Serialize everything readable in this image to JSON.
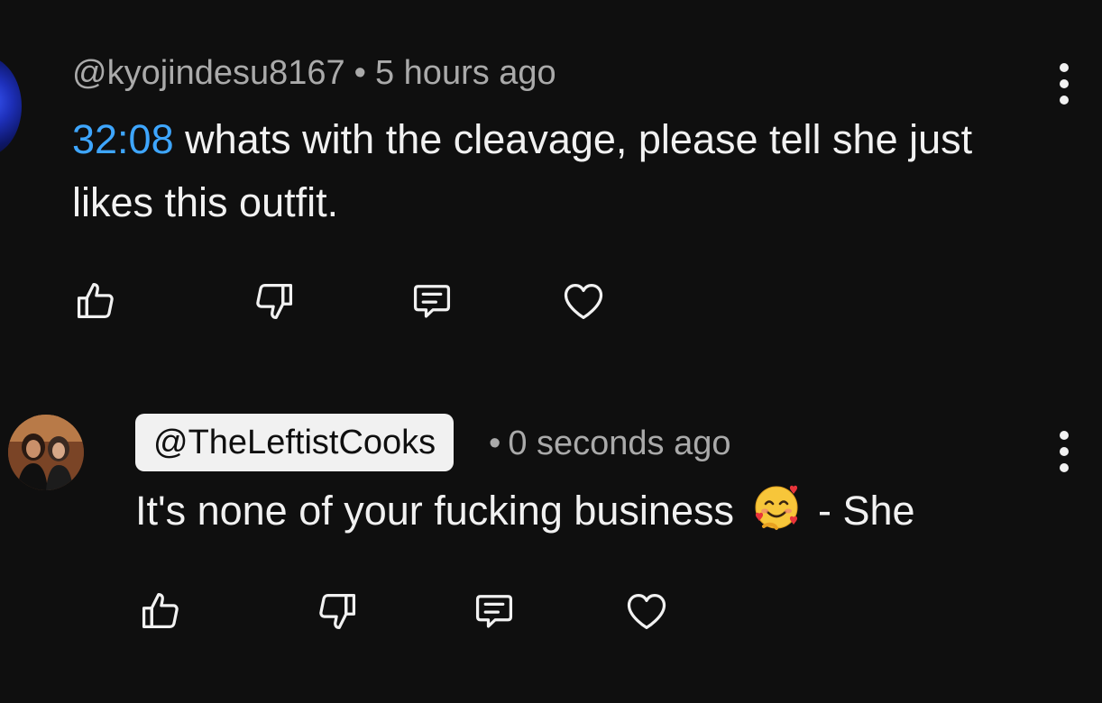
{
  "comments": [
    {
      "handle": "@kyojindesu8167",
      "separator": "•",
      "time": "5 hours ago",
      "timestamp_link": "32:08",
      "text": " whats with the cleavage, please tell she just likes this outfit."
    },
    {
      "handle": "@TheLeftistCooks",
      "separator": "•",
      "time": "0 seconds ago",
      "text_before_emoji": "It's none of your fucking business",
      "emoji_name": "smiling-face-with-hearts",
      "text_after_emoji": "- She"
    }
  ],
  "icons": {
    "like": "thumbs-up-icon",
    "dislike": "thumbs-down-icon",
    "reply": "comment-icon",
    "heart": "heart-icon",
    "more": "kebab-menu-icon"
  },
  "colors": {
    "background": "#0f0f0f",
    "text": "#f1f1f1",
    "secondary_text": "#aaaaaa",
    "timestamp_link": "#3ea6ff",
    "handle_chip_bg": "#f1f1f1"
  }
}
